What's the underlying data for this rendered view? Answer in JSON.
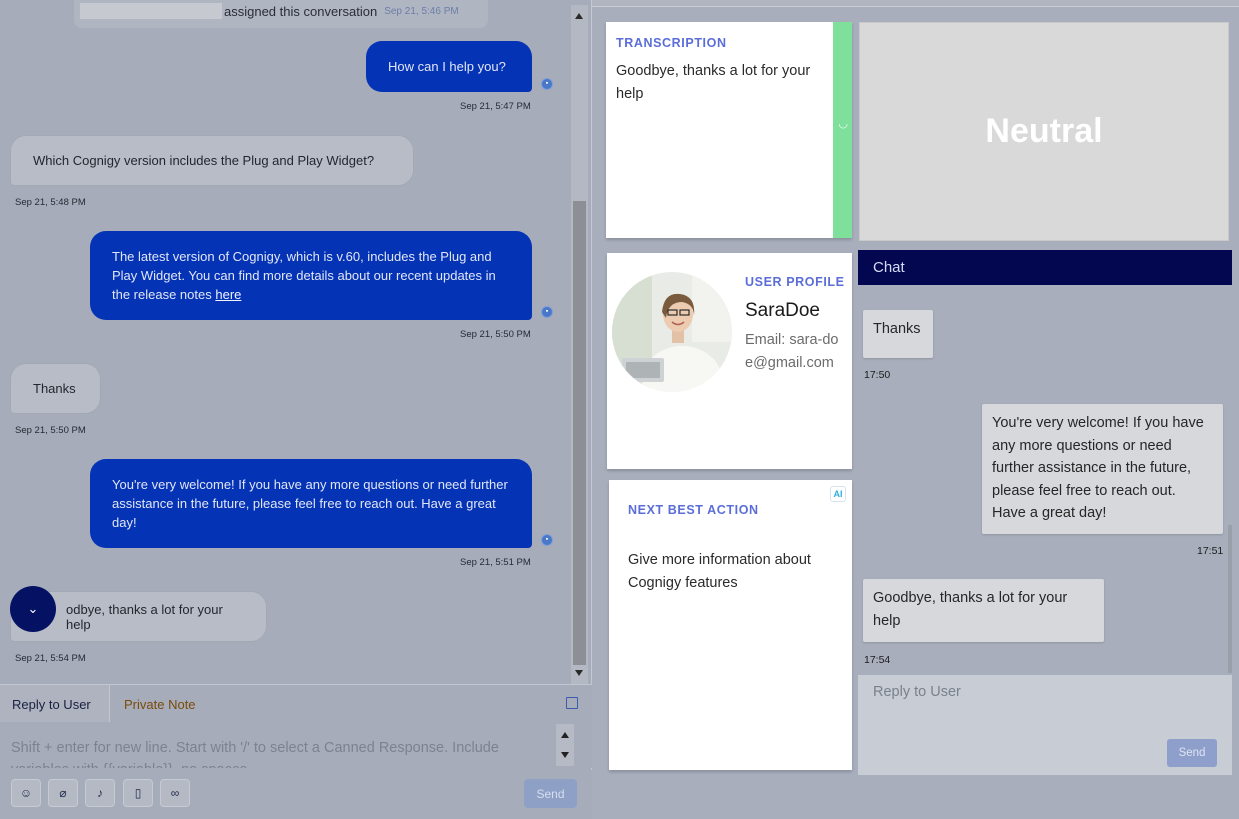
{
  "left_chat": {
    "system_message": {
      "text": "assigned this conversation",
      "time": "Sep 21, 5:46 PM"
    },
    "messages": [
      {
        "sender": "agent",
        "text": "How can I help you?",
        "time": "Sep 21, 5:47 PM"
      },
      {
        "sender": "user",
        "text": "Which Cognigy version includes the Plug and Play Widget?",
        "time": "Sep 21, 5:48 PM"
      },
      {
        "sender": "agent",
        "text": "The latest version of Cognigy, which is v.60, includes the Plug and Play Widget. You can find more details about our recent updates in the release notes",
        "link": "here",
        "time": "Sep 21, 5:50 PM"
      },
      {
        "sender": "user",
        "text": "Thanks",
        "time": "Sep 21, 5:50 PM"
      },
      {
        "sender": "agent",
        "text": "You're very welcome! If you have any more questions or need further assistance in the future, please feel free to reach out. Have a great day!",
        "time": "Sep 21, 5:51 PM"
      },
      {
        "sender": "user",
        "text": "odbye, thanks a lot for your help",
        "time": "Sep 21, 5:54 PM"
      }
    ],
    "scroll_down_icon": "chevron-down-icon"
  },
  "reply": {
    "tab_reply": "Reply to User",
    "tab_private": "Private Note",
    "placeholder": "Shift + enter for new line. Start with '/' to select a Canned Response. Include variables with {{variable}}, no spaces",
    "send_label": "Send",
    "tools": [
      "emoji-icon",
      "attachment-icon",
      "microphone-icon",
      "file-icon",
      "link-icon"
    ]
  },
  "transcription": {
    "title": "TRANSCRIPTION",
    "text": "Goodbye, thanks a lot for your help",
    "sentiment_color": "#7ee09a"
  },
  "sentiment": {
    "label": "Neutral"
  },
  "user_profile": {
    "title": "USER PROFILE",
    "name": "SaraDoe",
    "email": "Email: sara-doe@gmail.com"
  },
  "next_best_action": {
    "title": "NEXT BEST ACTION",
    "badge": "AI",
    "text": "Give more information about Cognigy features"
  },
  "right_chat": {
    "header": "Chat",
    "messages": [
      {
        "sender": "user",
        "text": "Thanks",
        "time": "17:50"
      },
      {
        "sender": "agent",
        "text": "You're very welcome! If you have any more questions or need further assistance in the future, please feel free to reach out. Have a great day!",
        "time": "17:51"
      },
      {
        "sender": "user",
        "text": "Goodbye, thanks a lot for your help",
        "time": "17:54"
      }
    ],
    "reply_placeholder": "Reply to User",
    "send_label": "Send"
  },
  "colors": {
    "agent_bubble": "#0433b6",
    "header_navy": "#030750",
    "card_title": "#5b6ed8"
  }
}
